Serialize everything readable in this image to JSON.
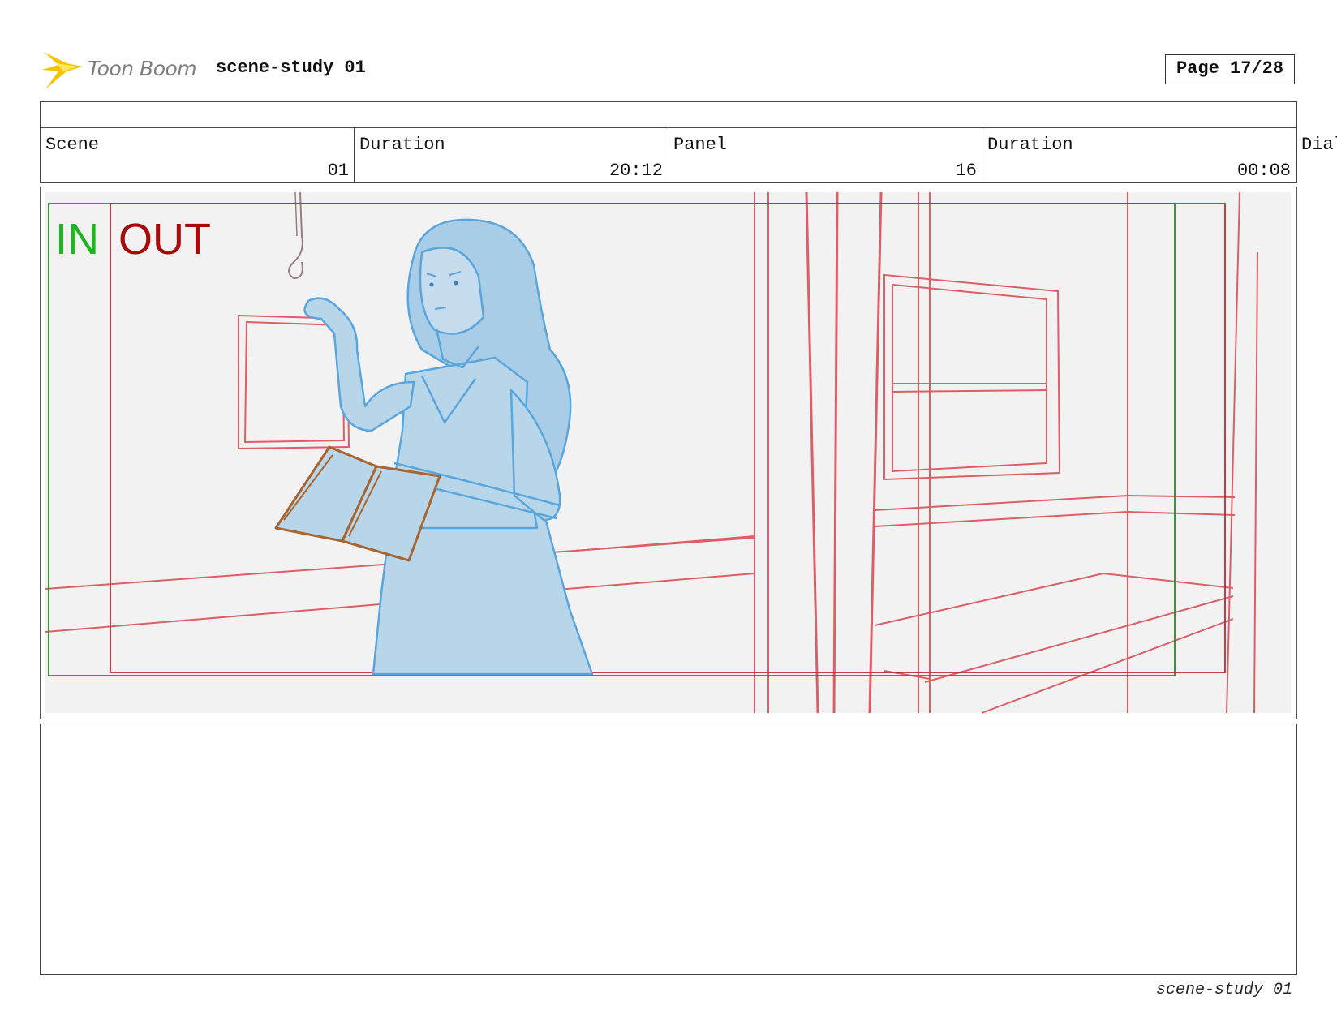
{
  "header": {
    "brand": "Toon Boom",
    "project_title": "scene-study 01",
    "page_label": "Page 17/28"
  },
  "info": {
    "scene_label": "Scene",
    "scene_value": "01",
    "scene_duration_label": "Duration",
    "scene_duration_value": "20:12",
    "panel_label": "Panel",
    "panel_value": "16",
    "panel_duration_label": "Duration",
    "panel_duration_value": "00:08",
    "dialogue_label": "Dialogue"
  },
  "panel": {
    "in_label": "IN",
    "out_label": "OUT",
    "colors": {
      "in_frame": "#2a8a2a",
      "in_text": "#1fb51f",
      "out_frame": "#b52a35",
      "out_text": "#a80b0b",
      "background_lines": "#d8464f",
      "character_fill": "#b8d6ea",
      "character_line": "#5aa6dc",
      "book": "#a86530",
      "panel_bg": "#f2f2f2"
    }
  },
  "dialogue": "",
  "footer": {
    "text": "scene-study 01"
  }
}
